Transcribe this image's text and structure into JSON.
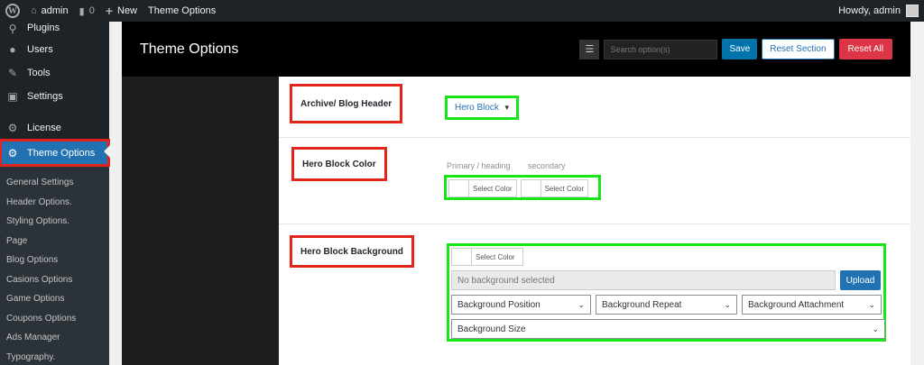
{
  "adminbar": {
    "site_name": "admin",
    "comments_count": "0",
    "new_label": "New",
    "theme_options_label": "Theme Options",
    "howdy": "Howdy, admin"
  },
  "sidebar": {
    "items": [
      {
        "label": "Plugins",
        "icon": "plugin-icon"
      },
      {
        "label": "Users",
        "icon": "users-icon"
      },
      {
        "label": "Tools",
        "icon": "wrench-icon"
      },
      {
        "label": "Settings",
        "icon": "settings-icon"
      },
      {
        "label": "License",
        "icon": "gear-icon"
      },
      {
        "label": "Theme Options",
        "icon": "gear-icon"
      }
    ],
    "submenu": [
      "General Settings",
      "Header Options.",
      "Styling Options.",
      "Page",
      "Blog Options",
      "Casions Options",
      "Game Options",
      "Coupons Options",
      "Ads Manager",
      "Typography."
    ]
  },
  "panel": {
    "title": "Theme Options",
    "search_placeholder": "Search option(s)",
    "save_label": "Save",
    "reset_section_label": "Reset Section",
    "reset_all_label": "Reset All"
  },
  "fields": {
    "archive_label": "Archive/ Blog Header",
    "archive_value": "Hero Block",
    "hero_color_label": "Hero Block Color",
    "primary_label": "Primary / heading",
    "secondary_label": "secondary",
    "select_color": "Select Color",
    "hero_bg_label": "Hero Block Background",
    "bg_placeholder": "No background selected",
    "upload_label": "Upload",
    "bg_position": "Background Position",
    "bg_repeat": "Background Repeat",
    "bg_attachment": "Background Attachment",
    "bg_size": "Background Size"
  },
  "colors": {
    "annotation_red": "#e2241a",
    "annotation_green": "#17e61a",
    "wp_blue": "#2271b1",
    "reset_red": "#dc3545"
  }
}
